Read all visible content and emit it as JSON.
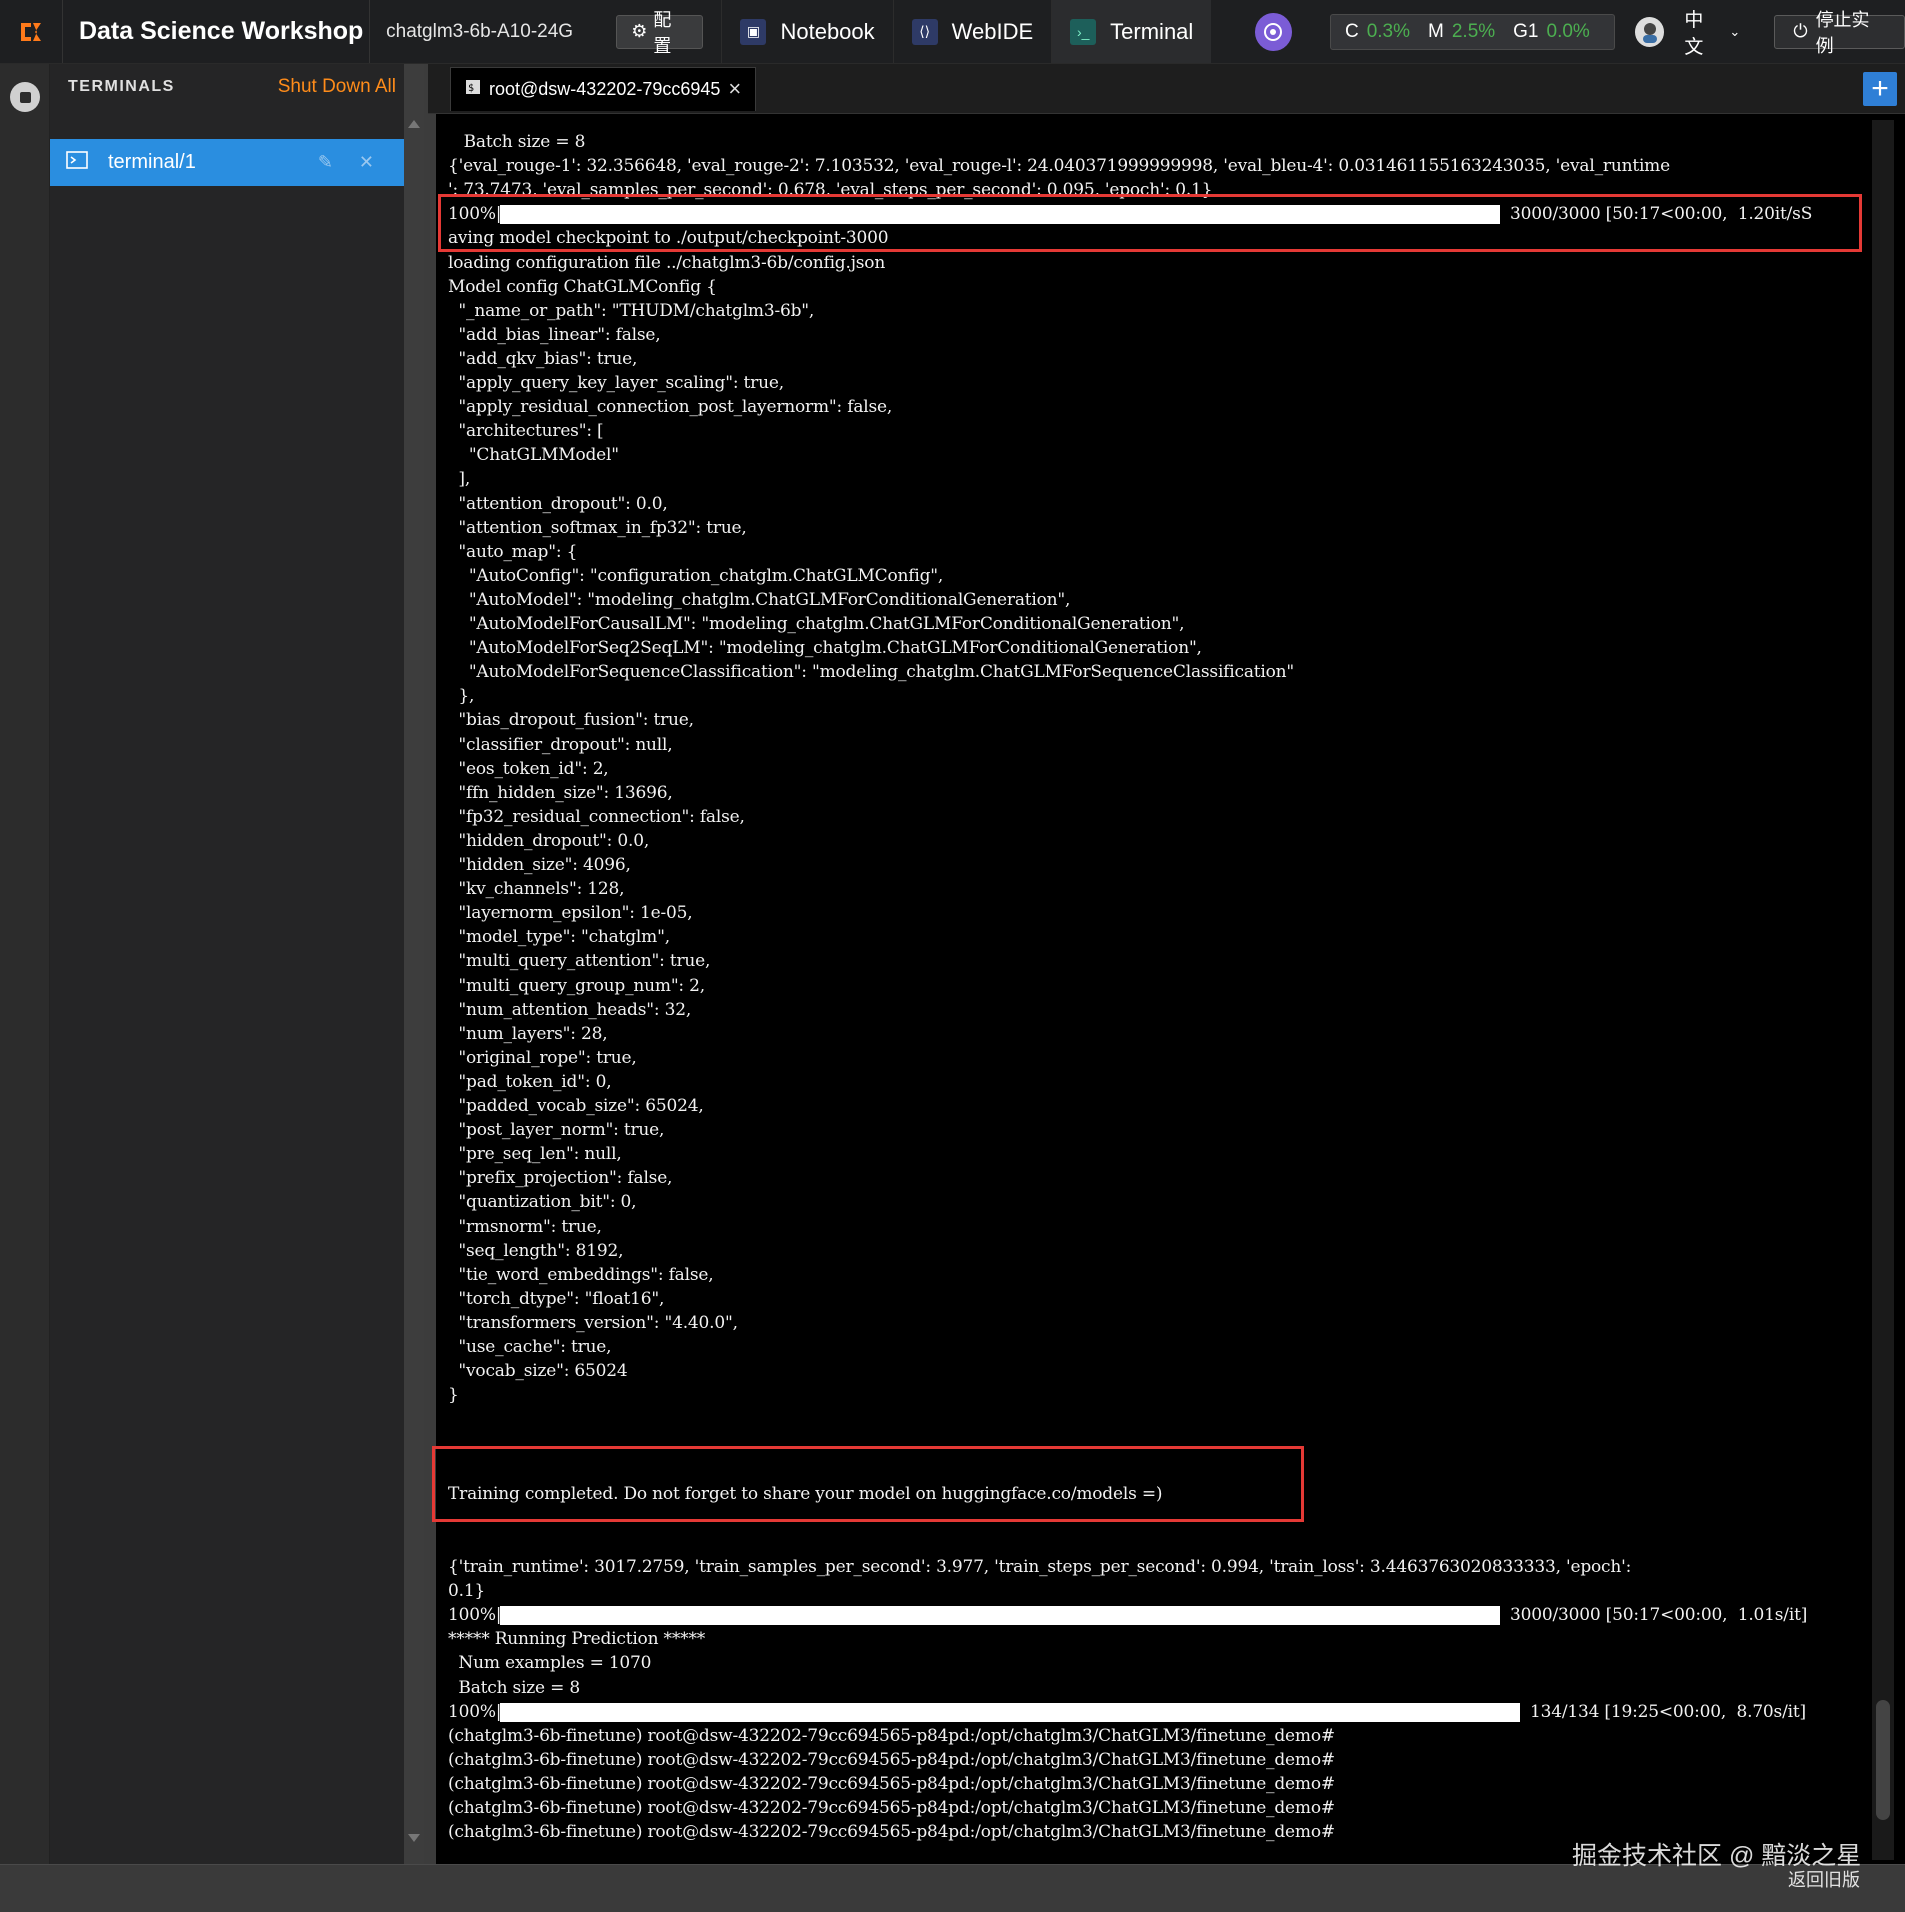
{
  "topbar": {
    "brand": "Data Science Workshop",
    "instance": "chatglm3-6b-A10-24G",
    "config_label": "配置",
    "tabs": [
      {
        "label": "Notebook"
      },
      {
        "label": "WebIDE"
      },
      {
        "label": "Terminal"
      }
    ],
    "metrics": {
      "c_label": "C",
      "c_value": "0.3%",
      "m_label": "M",
      "m_value": "2.5%",
      "g_label": "G1",
      "g_value": "0.0%"
    },
    "language": "中文",
    "stop_label": "停止实例"
  },
  "sidebar": {
    "title": "TERMINALS",
    "shutdown_label": "Shut Down All",
    "items": [
      {
        "label": "terminal/1"
      }
    ]
  },
  "tabbar": {
    "tab_label": "root@dsw-432202-79cc6945"
  },
  "terminal": {
    "lines": [
      "   Batch size = 8",
      "{'eval_rouge-1': 32.356648, 'eval_rouge-2': 7.103532, 'eval_rouge-l': 24.040371999999998, 'eval_bleu-4': 0.031461155163243035, 'eval_runtime",
      "': 73.7473, 'eval_samples_per_second': 0.678, 'eval_steps_per_second': 0.095, 'epoch': 0.1}",
      "100%|",
      "aving model checkpoint to ./output/checkpoint-3000",
      "loading configuration file ../chatglm3-6b/config.json",
      "Model config ChatGLMConfig {",
      "  \"_name_or_path\": \"THUDM/chatglm3-6b\",",
      "  \"add_bias_linear\": false,",
      "  \"add_qkv_bias\": true,",
      "  \"apply_query_key_layer_scaling\": true,",
      "  \"apply_residual_connection_post_layernorm\": false,",
      "  \"architectures\": [",
      "    \"ChatGLMModel\"",
      "  ],",
      "  \"attention_dropout\": 0.0,",
      "  \"attention_softmax_in_fp32\": true,",
      "  \"auto_map\": {",
      "    \"AutoConfig\": \"configuration_chatglm.ChatGLMConfig\",",
      "    \"AutoModel\": \"modeling_chatglm.ChatGLMForConditionalGeneration\",",
      "    \"AutoModelForCausalLM\": \"modeling_chatglm.ChatGLMForConditionalGeneration\",",
      "    \"AutoModelForSeq2SeqLM\": \"modeling_chatglm.ChatGLMForConditionalGeneration\",",
      "    \"AutoModelForSequenceClassification\": \"modeling_chatglm.ChatGLMForSequenceClassification\"",
      "  },",
      "  \"bias_dropout_fusion\": true,",
      "  \"classifier_dropout\": null,",
      "  \"eos_token_id\": 2,",
      "  \"ffn_hidden_size\": 13696,",
      "  \"fp32_residual_connection\": false,",
      "  \"hidden_dropout\": 0.0,",
      "  \"hidden_size\": 4096,",
      "  \"kv_channels\": 128,",
      "  \"layernorm_epsilon\": 1e-05,",
      "  \"model_type\": \"chatglm\",",
      "  \"multi_query_attention\": true,",
      "  \"multi_query_group_num\": 2,",
      "  \"num_attention_heads\": 32,",
      "  \"num_layers\": 28,",
      "  \"original_rope\": true,",
      "  \"pad_token_id\": 0,",
      "  \"padded_vocab_size\": 65024,",
      "  \"post_layer_norm\": true,",
      "  \"pre_seq_len\": null,",
      "  \"prefix_projection\": false,",
      "  \"quantization_bit\": 0,",
      "  \"rmsnorm\": true,",
      "  \"seq_length\": 8192,",
      "  \"tie_word_embeddings\": false,",
      "  \"torch_dtype\": \"float16\",",
      "  \"transformers_version\": \"4.40.0\",",
      "  \"use_cache\": true,",
      "  \"vocab_size\": 65024",
      "}"
    ],
    "progress1_suffix": "3000/3000 [50:17<00:00,  1.20it/sS",
    "training_completed": "Training completed. Do not forget to share your model on huggingface.co/models =)",
    "tail_lines": [
      "{'train_runtime': 3017.2759, 'train_samples_per_second': 3.977, 'train_steps_per_second': 0.994, 'train_loss': 3.4463763020833333, 'epoch':",
      "0.1}",
      "100%|",
      "***** Running Prediction *****",
      "  Num examples = 1070",
      "  Batch size = 8",
      "100%|",
      "(chatglm3-6b-finetune) root@dsw-432202-79cc694565-p84pd:/opt/chatglm3/ChatGLM3/finetune_demo#",
      "(chatglm3-6b-finetune) root@dsw-432202-79cc694565-p84pd:/opt/chatglm3/ChatGLM3/finetune_demo#",
      "(chatglm3-6b-finetune) root@dsw-432202-79cc694565-p84pd:/opt/chatglm3/ChatGLM3/finetune_demo#",
      "(chatglm3-6b-finetune) root@dsw-432202-79cc694565-p84pd:/opt/chatglm3/ChatGLM3/finetune_demo#",
      "(chatglm3-6b-finetune) root@dsw-432202-79cc694565-p84pd:/opt/chatglm3/ChatGLM3/finetune_demo#"
    ],
    "progress2_suffix": "3000/3000 [50:17<00:00,  1.01s/it]",
    "progress3_suffix": "134/134 [19:25<00:00,  8.70s/it]",
    "progress_value": 1.0
  },
  "watermark": {
    "text": "掘金技术社区 @ 黯淡之星",
    "sub": "返回旧版"
  },
  "colors": {
    "accent": "#2a8ee0",
    "shutdown": "#ff8c1a",
    "highlight": "#e53935",
    "metric_value": "#4caf50"
  }
}
